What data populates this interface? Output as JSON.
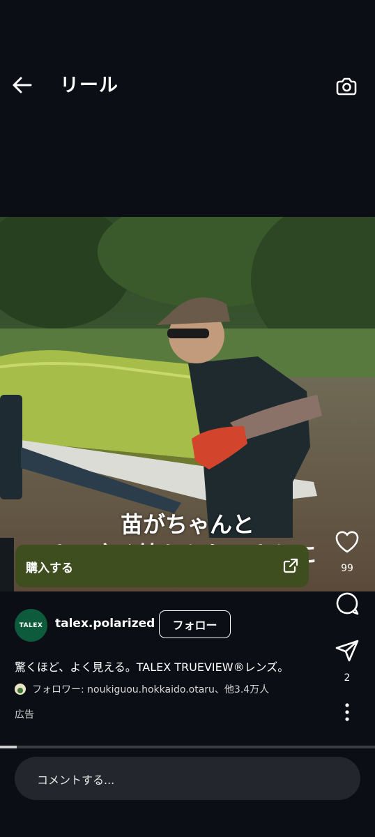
{
  "header": {
    "title": "リール"
  },
  "video": {
    "subtitle_line1": "苗がちゃんと",
    "subtitle_line2": "よ　広く植えられるように"
  },
  "cta": {
    "label": "購入する"
  },
  "rail": {
    "likes": "99",
    "shares": "2"
  },
  "post": {
    "avatar_text": "TALEX",
    "username": "talex.polarized",
    "follow_label": "フォロー",
    "caption": "驚くほど、よく見える。TALEX TRUEVIEW®レンズ。",
    "followers_text": "フォロワー: noukiguou.hokkaido.otaru、他3.4万人",
    "ad_label": "広告"
  },
  "playback": {
    "progress_fraction": 0.045
  },
  "comment": {
    "placeholder": "コメントする..."
  },
  "colors": {
    "background": "#0b0e14",
    "cta_green": "#3f4e1e",
    "avatar_green": "#0e5a3c"
  }
}
